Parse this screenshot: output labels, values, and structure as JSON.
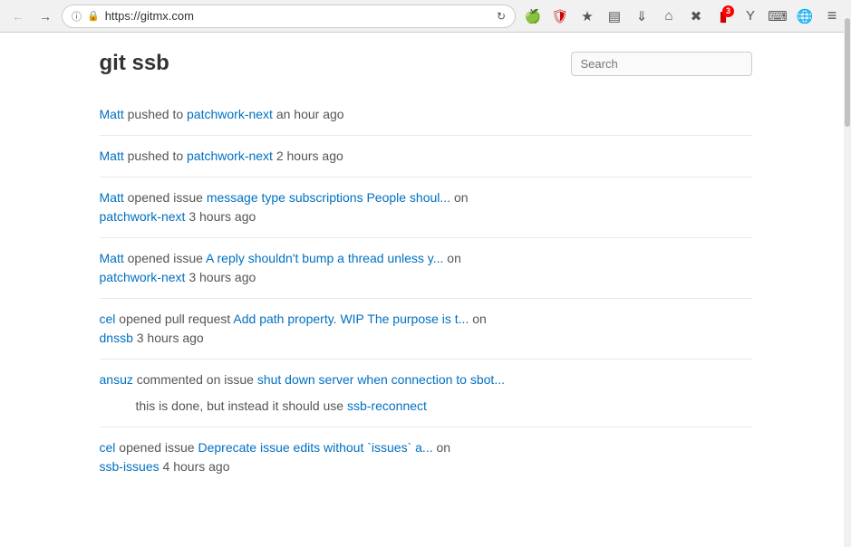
{
  "browser": {
    "url": "https://gitmx.com",
    "badge_count": "3"
  },
  "page": {
    "title": "git ssb",
    "search_placeholder": "Search"
  },
  "activities": [
    {
      "id": 1,
      "actor": "Matt",
      "action": "pushed to",
      "target": "patchwork-next",
      "time": "an hour ago",
      "type": "push",
      "suffix": null,
      "quote": null,
      "repo": null
    },
    {
      "id": 2,
      "actor": "Matt",
      "action": "pushed to",
      "target": "patchwork-next",
      "time": "2 hours ago",
      "type": "push",
      "suffix": null,
      "quote": null,
      "repo": null
    },
    {
      "id": 3,
      "actor": "Matt",
      "action": "opened issue",
      "target": "message type subscriptions People shoul...",
      "time": "3 hours ago",
      "type": "issue",
      "suffix": "on",
      "repo": "patchwork-next",
      "quote": null
    },
    {
      "id": 4,
      "actor": "Matt",
      "action": "opened issue",
      "target": "A reply shouldn't bump a thread unless y...",
      "time": "3 hours ago",
      "type": "issue",
      "suffix": "on",
      "repo": "patchwork-next",
      "quote": null
    },
    {
      "id": 5,
      "actor": "cel",
      "action": "opened pull request",
      "target": "Add path property. WIP The purpose is t...",
      "time": "3 hours ago",
      "type": "pull",
      "suffix": "on",
      "repo": "dnssb",
      "quote": null
    },
    {
      "id": 6,
      "actor": "ansuz",
      "action": "commented on issue",
      "target": "shut down server when connection to sbot...",
      "time": null,
      "type": "comment",
      "suffix": null,
      "repo": null,
      "quote": "this is done, but instead it should use",
      "quote_link": "ssb-reconnect"
    },
    {
      "id": 7,
      "actor": "cel",
      "action": "opened issue",
      "target": "Deprecate issue edits without `issues` a...",
      "time": "4 hours ago",
      "type": "issue",
      "suffix": "on",
      "repo": "ssb-issues",
      "quote": null
    }
  ]
}
